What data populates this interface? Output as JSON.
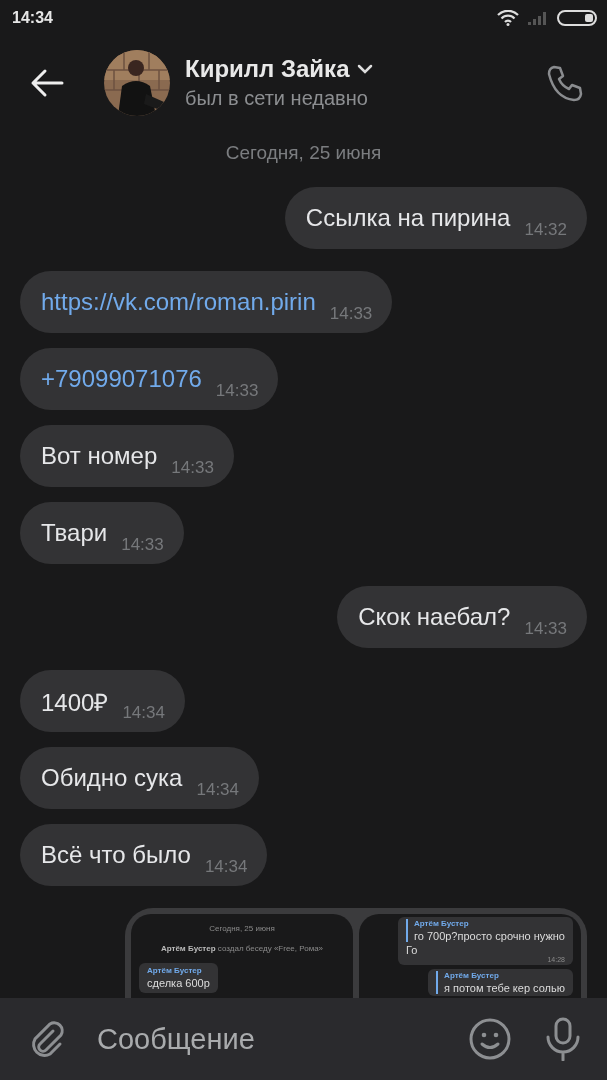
{
  "status_bar": {
    "time": "14:34"
  },
  "header": {
    "name": "Кирилл Зайка",
    "status": "был в сети недавно"
  },
  "date_divider": "Сегодня, 25 июня",
  "messages": [
    {
      "outgoing": true,
      "kind": "text",
      "text": "Ссылка на пирина",
      "time": "14:32"
    },
    {
      "outgoing": false,
      "kind": "link",
      "text": "https://vk.com/roman.pirin",
      "time": "14:33"
    },
    {
      "outgoing": false,
      "kind": "link",
      "text": "+79099071076",
      "time": "14:33"
    },
    {
      "outgoing": false,
      "kind": "text",
      "text": "Вот номер",
      "time": "14:33"
    },
    {
      "outgoing": false,
      "kind": "text",
      "text": "Твари",
      "time": "14:33"
    },
    {
      "outgoing": true,
      "kind": "text",
      "text": "Скок наебал?",
      "time": "14:33"
    },
    {
      "outgoing": false,
      "kind": "text",
      "text": "1400₽",
      "time": "14:34"
    },
    {
      "outgoing": false,
      "kind": "text",
      "text": "Обидно сука",
      "time": "14:34"
    },
    {
      "outgoing": false,
      "kind": "text",
      "text": "Всё что было",
      "time": "14:34"
    }
  ],
  "attachment": {
    "panels": [
      {
        "date": "Сегодня, 25 июня",
        "system_text": "**Артём Бустер** создал беседу «Free, Рома»",
        "bubbles": [
          {
            "sender": "Артём Бустер",
            "text": "сделка 600р"
          }
        ]
      },
      {
        "bubbles": [
          {
            "quote_sender": "Артём Бустер",
            "quote_text": "го 700р?просто срочно нужно",
            "text": "Го",
            "time": "14:28"
          },
          {
            "quote_sender": "Артём Бустер",
            "quote_text": "я потом тебе кер солью"
          }
        ]
      }
    ]
  },
  "composer": {
    "placeholder": "Сообщение"
  }
}
